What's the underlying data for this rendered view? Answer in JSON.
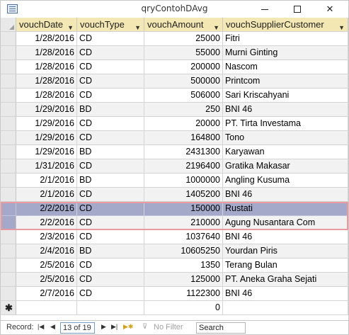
{
  "window": {
    "title": "qryContohDAvg"
  },
  "columns": [
    {
      "label": "vouchDate"
    },
    {
      "label": "vouchType"
    },
    {
      "label": "vouchAmount"
    },
    {
      "label": "vouchSupplierCustomer"
    }
  ],
  "rows": [
    {
      "date": "1/28/2016",
      "type": "CD",
      "amount": "25000",
      "party": "Fitri"
    },
    {
      "date": "1/28/2016",
      "type": "CD",
      "amount": "55000",
      "party": "Murni Ginting"
    },
    {
      "date": "1/28/2016",
      "type": "CD",
      "amount": "200000",
      "party": "Nascom"
    },
    {
      "date": "1/28/2016",
      "type": "CD",
      "amount": "500000",
      "party": "Printcom"
    },
    {
      "date": "1/28/2016",
      "type": "CD",
      "amount": "506000",
      "party": "Sari Kriscahyani"
    },
    {
      "date": "1/29/2016",
      "type": "BD",
      "amount": "250",
      "party": "BNI 46"
    },
    {
      "date": "1/29/2016",
      "type": "CD",
      "amount": "20000",
      "party": "PT. Tirta Investama"
    },
    {
      "date": "1/29/2016",
      "type": "CD",
      "amount": "164800",
      "party": "Tono"
    },
    {
      "date": "1/29/2016",
      "type": "BD",
      "amount": "2431300",
      "party": "Karyawan"
    },
    {
      "date": "1/31/2016",
      "type": "CD",
      "amount": "2196400",
      "party": "Gratika Makasar"
    },
    {
      "date": "2/1/2016",
      "type": "BD",
      "amount": "1000000",
      "party": "Angling Kusuma"
    },
    {
      "date": "2/1/2016",
      "type": "CD",
      "amount": "1405200",
      "party": "BNI 46"
    },
    {
      "date": "2/2/2016",
      "type": "CD",
      "amount": "150000",
      "party": "Rustati"
    },
    {
      "date": "2/2/2016",
      "type": "CD",
      "amount": "210000",
      "party": "Agung Nusantara Com"
    },
    {
      "date": "2/3/2016",
      "type": "CD",
      "amount": "1037640",
      "party": "BNI 46"
    },
    {
      "date": "2/4/2016",
      "type": "BD",
      "amount": "10605250",
      "party": "Yourdan Piris"
    },
    {
      "date": "2/5/2016",
      "type": "CD",
      "amount": "1350",
      "party": "Terang Bulan"
    },
    {
      "date": "2/5/2016",
      "type": "CD",
      "amount": "125000",
      "party": "PT. Aneka Graha Sejati"
    },
    {
      "date": "2/7/2016",
      "type": "CD",
      "amount": "1122300",
      "party": "BNI 46"
    }
  ],
  "new_row": {
    "marker": "✱",
    "amount": "0"
  },
  "navigation": {
    "record_label": "Record:",
    "position": "13 of 19",
    "filter_label": "No Filter",
    "search_value": "Search"
  },
  "colors": {
    "header_bg": "#f3e8b3",
    "selection_bg": "#a4a8c9",
    "selection_border": "#e79aa0"
  }
}
